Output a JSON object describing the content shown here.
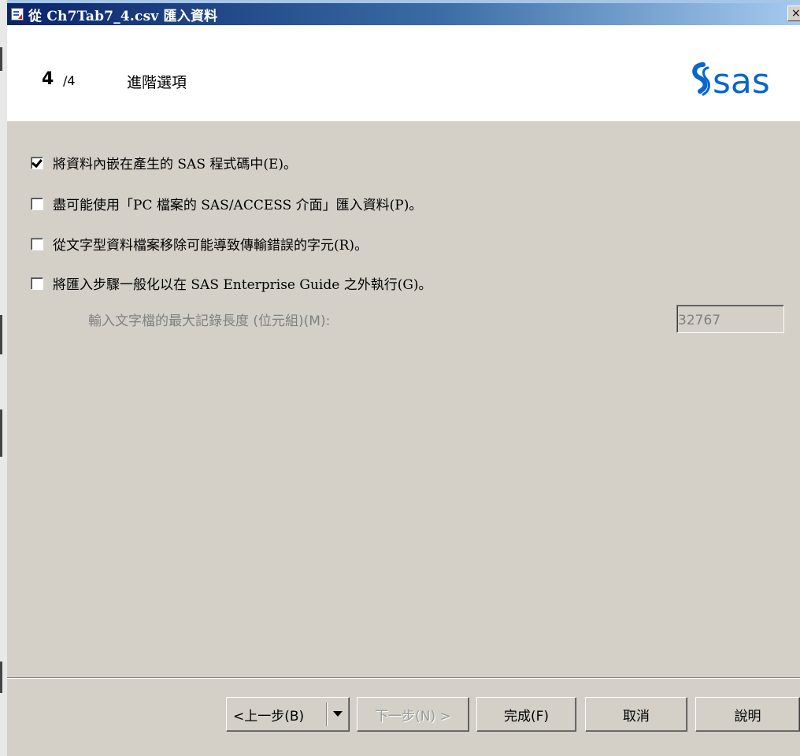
{
  "window": {
    "title": "從 Ch7Tab7_4.csv 匯入資料",
    "close_glyph": "×"
  },
  "header": {
    "step_current": "4",
    "step_total": "/4",
    "step_title": "進階選項",
    "logo_text": "sas",
    "logo_color": "#0766d1"
  },
  "options": [
    {
      "label": "將資料內嵌在產生的 SAS 程式碼中(E)。",
      "checked": true
    },
    {
      "label": "盡可能使用「PC 檔案的 SAS/ACCESS 介面」匯入資料(P)。",
      "checked": false
    },
    {
      "label": "從文字型資料檔案移除可能導致傳輸錯誤的字元(R)。",
      "checked": false
    },
    {
      "label": "將匯入步驟一般化以在 SAS Enterprise Guide 之外執行(G)。",
      "checked": false
    }
  ],
  "max_record": {
    "label": "輸入文字檔的最大記錄長度 (位元組)(M):",
    "value": "32767"
  },
  "buttons": {
    "back": "<上一步(B)",
    "next": "下一步(N) >",
    "finish": "完成(F)",
    "cancel": "取消",
    "help": "說明"
  }
}
